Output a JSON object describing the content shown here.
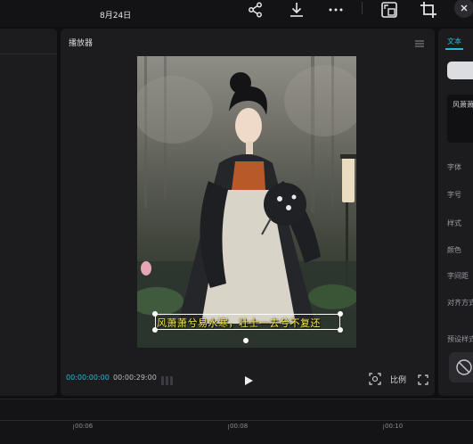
{
  "header": {
    "date": "8月24日"
  },
  "player": {
    "title": "播放器",
    "subtitle": "风萧萧兮易水寒，壮士一去兮不复还",
    "current_time": "00:00:00:00",
    "total_time": "00:00:29:00",
    "ratio_label": "比例"
  },
  "inspector": {
    "tab": "文本",
    "text_value": "风萧萧",
    "labels": {
      "font": "字体",
      "size": "字号",
      "style": "样式",
      "color": "颜色",
      "spacing": "字间距",
      "align": "对齐方式",
      "preset": "预设样式"
    }
  },
  "timeline": {
    "ticks": [
      "00:06",
      "00:08",
      "00:10"
    ]
  },
  "icons": {
    "share": "share-icon",
    "download": "download-icon",
    "more": "more-icon",
    "crop": "crop-icon",
    "close": "close-icon"
  },
  "colors": {
    "accent": "#2bb8d6",
    "subtitle": "#fff24a",
    "panel": "#1c1c1f"
  }
}
